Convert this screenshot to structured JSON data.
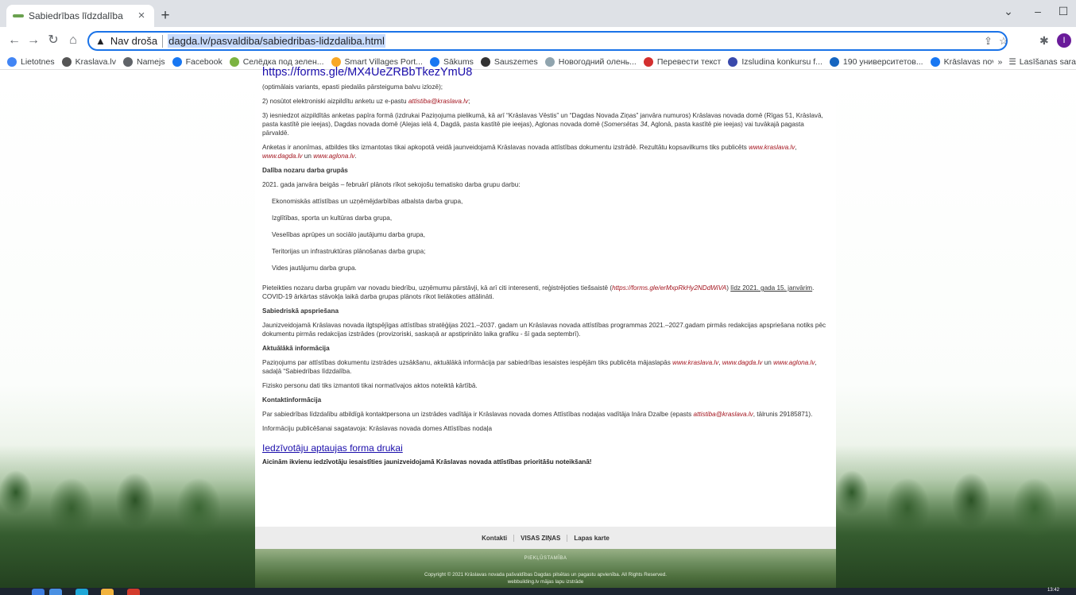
{
  "browser": {
    "tab_title": "Sabiedrības līdzdalība",
    "tab_close": "×",
    "new_tab": "+",
    "security_label": "Nav droša",
    "url": "dagda.lv/pasvaldiba/sabiedribas-lidzdaliba.html",
    "bookmarks": [
      {
        "label": "Lietotnes",
        "icon": "apps-grid-icon",
        "color": "#4285f4"
      },
      {
        "label": "Kraslava.lv",
        "icon": "k-logo-icon",
        "color": "#555555"
      },
      {
        "label": "Namejs",
        "icon": "globe-icon",
        "color": "#5f6368"
      },
      {
        "label": "Facebook",
        "icon": "facebook-icon",
        "color": "#1877f2"
      },
      {
        "label": "Селёдка под зелен...",
        "icon": "green-circle-icon",
        "color": "#7cb342"
      },
      {
        "label": "Smart Villages Port...",
        "icon": "smart-villages-icon",
        "color": "#f9a825"
      },
      {
        "label": "Sākums",
        "icon": "facebook-icon",
        "color": "#1877f2"
      },
      {
        "label": "Sauszemes",
        "icon": "footprints-icon",
        "color": "#333333"
      },
      {
        "label": "Новогодний олень...",
        "icon": "deer-icon",
        "color": "#90a4ae"
      },
      {
        "label": "Перевести текст",
        "icon": "translate-icon",
        "color": "#d32f2f"
      },
      {
        "label": "Izsludina konkursu f...",
        "icon": "emblem-icon",
        "color": "#3949ab"
      },
      {
        "label": "190 университетов...",
        "icon": "person-icon",
        "color": "#1565c0"
      },
      {
        "label": "Krāslavas novada d...",
        "icon": "facebook-icon",
        "color": "#1877f2"
      }
    ],
    "more_bookmarks": "»",
    "reading_list": "Lasīšanas sara",
    "profile_initial": "I"
  },
  "content": {
    "top_link": "https://forms.gle/MX4UeZRBbTkezYmU8",
    "p_optimal": "(optimālais variants, epasti piedalās pārsteiguma balvu izlozē);",
    "p2_a": "2) nosūtot elektroniski aizpildītu anketu uz e-pastu ",
    "p2_email": "attistiba@kraslava.lv",
    "p2_b": ";",
    "p3_a": "3) iesniedzot aizpildītās anketas papīra formā (izdrukai Paziņojuma pielikumā, kā arī “Krāslavas Vēstis” un “Dagdas Novada Ziņas” janvāra numuros) Krāslavas novada domē (Rīgas 51, Krāslavā, pasta kastītē pie ieejas), Dagdas novada domē (Alejas ielā 4, Dagdā, pasta kastītē pie ieejas), Aglonas novada domē (",
    "p3_em": "Somersētas 34",
    "p3_b": ", Aglonā, pasta kastītē pie ieejas) vai tuvākajā pagasta pārvaldē.",
    "p_anon_a": "Anketas ir anonīmas, atbildes tiks izmantotas tikai apkopotā veidā jaunveidojamā Krāslavas novada attīstības dokumentu izstrādē. Rezultātu kopsavilkums tiks publicēts ",
    "link_kraslava": "www.kraslava.lv",
    "sep_comma": ", ",
    "link_dagda": "www.dagda.lv",
    "sep_un": " un ",
    "link_aglona": "www.aglona.lv",
    "p_anon_end": ".",
    "h_groups": "Dalība nozaru darba grupās",
    "p_groups": "2021. gada janvāra beigās – februārī plānots rīkot sekojošu tematisko darba grupu darbu:",
    "groups": [
      "Ekonomiskās attīstības un uzņēmējdarbības atbalsta darba grupa,",
      "Izglītības, sporta un kultūras darba grupa,",
      "Veselības aprūpes un sociālo jautājumu darba grupa,",
      "Teritorijas un infrastruktūras plānošanas darba grupa;",
      "Vides jautājumu darba grupa."
    ],
    "p_apply_a": "Pieteikties nozaru darba grupām var novadu biedrību, uzņēmumu pārstāvji, kā arī citi interesenti, reģistrējoties tiešsaistē (",
    "p_apply_link": "https://forms.gle/erMxpRkHy2NDdWiVA",
    "p_apply_b": ") ",
    "p_apply_u": "līdz 2021. gada 15. janvārim",
    "p_apply_c": ". COVID-19 ārkārtas stāvokļa laikā darba grupas plānots rīkot lielākoties attālināti.",
    "h_public": "Sabiedriskā apspriešana",
    "p_public": "Jaunizveidojamā Krāslavas novada ilgtspējīgas attīstības stratēģijas 2021.–2037. gadam un Krāslavas novada attīstības programmas 2021.–2027.gadam pirmās redakcijas apspriešana notiks pēc dokumentu pirmās redakcijas izstrādes (provizoriski, saskaņā ar apstiprināto laika grafiku - šī gada septembrī).",
    "h_info": "Aktuālākā informācija",
    "p_info_a": "Paziņojums par attīstības dokumentu izstrādes uzsākšanu, aktuālākā informācija par sabiedrības iesaistes iespējām tiks publicēta mājaslapās ",
    "p_info_b": ", sadaļā “Sabiedrības līdzdalība.",
    "p_personal": "Fizisko personu dati tiks izmantoti tikai normatīvajos aktos noteiktā kārtībā.",
    "h_contact": "Kontaktinformācija",
    "p_contact_a": "Par sabiedrības līdzdalību atbildīgā kontaktpersona un izstrādes vadītāja ir Krāslavas novada domes Attīstības nodaļas vadītāja Ināra Dzalbe (epasts ",
    "p_contact_b": ", tālrunis 29185871).",
    "p_prepared": "Informāciju publicēšanai sagatavoja: Krāslavas novada domes Attīstības nodaļa",
    "form_link": "Iedzīvotāju aptaujas forma drukai",
    "invite": "Aicinām ikvienu iedzīvotāju iesaistīties jaunizveidojamā Krāslavas novada attīstības prioritāšu noteikšanā!"
  },
  "footer": {
    "nav": [
      "Kontakti",
      "VISAS ZIŅAS",
      "Lapas karte"
    ],
    "accessibility": "PIEKĻŪSTAMĪBA",
    "copyright": "Copyright © 2021 Krāslavas novada pašvaldības Dagdas pilsētas un pagastu apvienība. All Rights Reserved.",
    "credit": "webbuilding.lv mājas lapu izstrāde"
  },
  "taskbar": {
    "time": "13:42"
  }
}
